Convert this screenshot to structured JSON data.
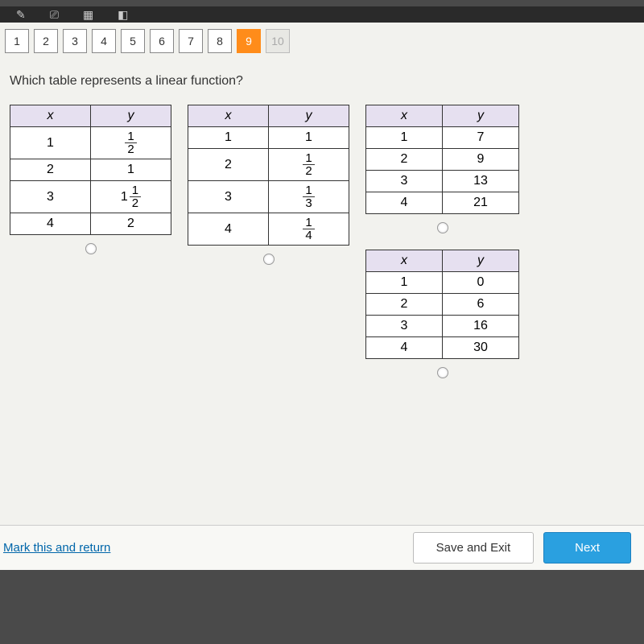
{
  "nav": {
    "items": [
      "1",
      "2",
      "3",
      "4",
      "5",
      "6",
      "7",
      "8",
      "9",
      "10"
    ],
    "active_index": 8,
    "disabled_index": 9
  },
  "question": "Which table represents a linear function?",
  "tables": [
    {
      "width_cols": [
        100,
        100
      ],
      "headers": [
        "x",
        "y"
      ],
      "rows": [
        [
          "1",
          {
            "frac": [
              "1",
              "2"
            ]
          }
        ],
        [
          "2",
          "1"
        ],
        [
          "3",
          {
            "mixed": [
              "1",
              "1",
              "2"
            ]
          }
        ],
        [
          "4",
          "2"
        ]
      ]
    },
    {
      "width_cols": [
        100,
        100
      ],
      "headers": [
        "x",
        "y"
      ],
      "rows": [
        [
          "1",
          "1"
        ],
        [
          "2",
          {
            "frac": [
              "1",
              "2"
            ]
          }
        ],
        [
          "3",
          {
            "frac": [
              "1",
              "3"
            ]
          }
        ],
        [
          "4",
          {
            "frac": [
              "1",
              "4"
            ]
          }
        ]
      ]
    },
    {
      "width_cols": [
        95,
        95
      ],
      "headers": [
        "x",
        "y"
      ],
      "rows": [
        [
          "1",
          "7"
        ],
        [
          "2",
          "9"
        ],
        [
          "3",
          "13"
        ],
        [
          "4",
          "21"
        ]
      ]
    },
    {
      "width_cols": [
        95,
        95
      ],
      "headers": [
        "x",
        "y"
      ],
      "rows": [
        [
          "1",
          "0"
        ],
        [
          "2",
          "6"
        ],
        [
          "3",
          "16"
        ],
        [
          "4",
          "30"
        ]
      ]
    }
  ],
  "footer": {
    "mark": "Mark this and return",
    "save": "Save and Exit",
    "next": "Next"
  }
}
